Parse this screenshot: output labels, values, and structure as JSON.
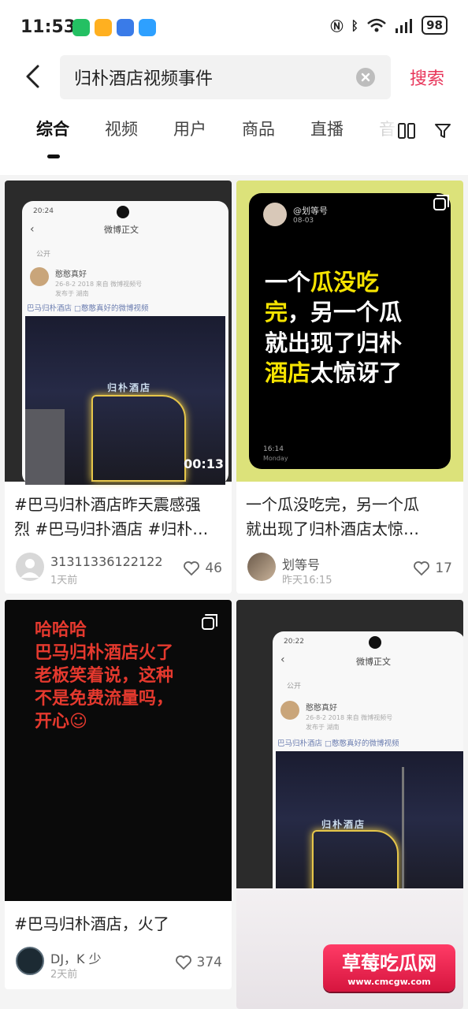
{
  "status_bar": {
    "time": "11:53",
    "battery": "98"
  },
  "search": {
    "query": "归朴酒店视频事件",
    "button_label": "搜索"
  },
  "tabs": [
    "综合",
    "视频",
    "用户",
    "商品",
    "直播",
    "音"
  ],
  "cards": [
    {
      "title": "#巴马归朴酒店昨天震感强\n烈 #巴马归扑酒店 #归朴…",
      "author": "31311336122122",
      "time": "1天前",
      "likes": "46",
      "duration": "00:13",
      "inner": {
        "app_title": "微博正文",
        "visibility": "公开",
        "user": "憨憨真好",
        "meta": "26-8-2 2018  来自 微博视频号",
        "meta2": "发布于 湖南",
        "caption": "巴马归朴酒店 □憨憨真好的微博视频",
        "time": "20:24"
      }
    },
    {
      "title": "一个瓜没吃完，另一个瓜\n就出现了归朴酒店太惊…",
      "author": "划等号",
      "time": "昨天16:15",
      "likes": "17",
      "inner": {
        "handle": "@划等号",
        "date": "08-03",
        "line1_a": "一个",
        "line1_b": "瓜没吃",
        "line2_a": "完",
        "line2_b": "，另一个瓜",
        "line3": "就出现了归朴",
        "line4_a": "酒店",
        "line4_b": "太惊讶了",
        "footer_time": "16:14",
        "footer_day": "Monday"
      }
    },
    {
      "title": "#巴马归朴酒店，火了",
      "author": "DJ，K 少",
      "time": "2天前",
      "likes": "374",
      "inner": {
        "line1": "哈哈哈",
        "line2": "巴马归朴酒店火了",
        "line3": "老板笑着说，这种",
        "line4": "不是免费流量吗，",
        "line5": "开心☺"
      }
    },
    {
      "inner": {
        "app_title": "微博正文",
        "visibility": "公开",
        "user": "憨憨真好",
        "meta": "26-8-2 2018  来自 微博视频号",
        "meta2": "发布于 湖南",
        "caption": "巴马归朴酒店 □憨憨真好的微博视频",
        "time": "20:22"
      }
    }
  ],
  "watermark": {
    "text": "草莓吃瓜网",
    "url": "www.cmcgw.com"
  },
  "colors": {
    "accent": "#e8355a",
    "yellow": "#f5e300",
    "green_card_bg": "#dce27a",
    "red_text": "#e5392e"
  }
}
